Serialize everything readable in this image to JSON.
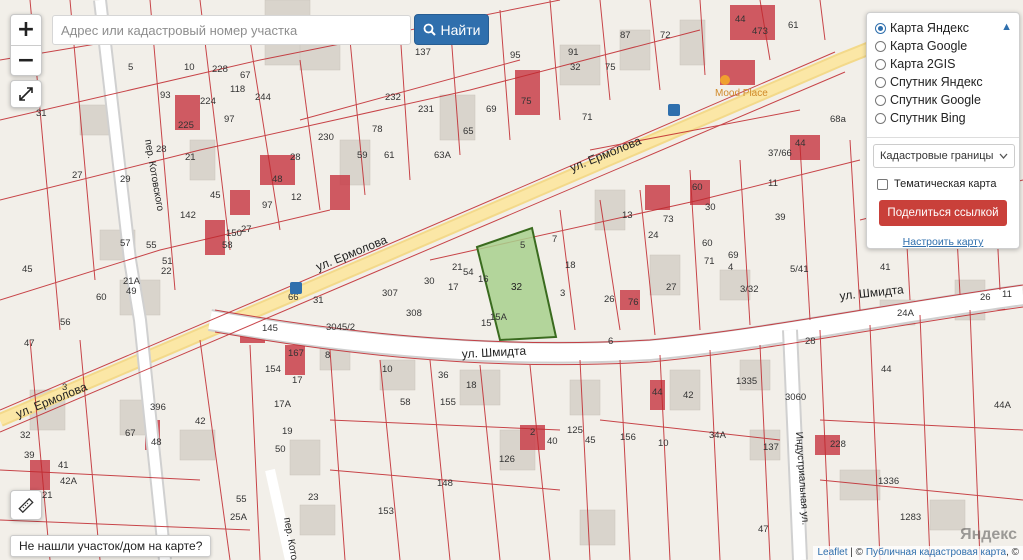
{
  "search": {
    "placeholder": "Адрес или кадастровый номер участка",
    "button_label": "Найти"
  },
  "zoom": {
    "in_label": "+",
    "out_label": "−"
  },
  "panel": {
    "basemaps": [
      {
        "label": "Карта Яндекс",
        "selected": true
      },
      {
        "label": "Карта Google",
        "selected": false
      },
      {
        "label": "Карта 2GIS",
        "selected": false
      },
      {
        "label": "Спутник Яндекс",
        "selected": false
      },
      {
        "label": "Спутник Google",
        "selected": false
      },
      {
        "label": "Спутник Bing",
        "selected": false
      }
    ],
    "layer_select": "Кадастровые границы",
    "thematic_label": "Тематическая карта",
    "thematic_checked": false,
    "share_label": "Поделиться ссылкой",
    "setup_label": "Настроить карту"
  },
  "notfound_label": "Не нашли участок/дом на карте?",
  "attribution": {
    "leaflet": "Leaflet",
    "sep": " | © ",
    "pkk": "Публичная кадастровая карта",
    "tail": ", ©"
  },
  "yandex_logo": "Яндекс",
  "map": {
    "streets": [
      {
        "name": "ул. Ермолова",
        "id": "ermolova-upper"
      },
      {
        "name": "ул. Ермолова",
        "id": "ermolova-mid"
      },
      {
        "name": "ул. Ермолова",
        "id": "ermolova-lower"
      },
      {
        "name": "ул. Шмидта",
        "id": "shmidta-mid"
      },
      {
        "name": "ул. Шмидта",
        "id": "shmidta-right"
      },
      {
        "name": "пер. Котовского",
        "id": "kotovskogo"
      },
      {
        "name": "пер. Кото",
        "id": "koto-bottom"
      },
      {
        "name": "Индустриальная ул.",
        "id": "industrialnaya"
      }
    ],
    "poi": "Mood Place",
    "selected_parcel": "32",
    "colors": {
      "background": "#f2efe9",
      "parcel_line": "#c0272d",
      "building": "#d9d4cc",
      "highlight_building": "#c9404a",
      "road": "#fbe7a6",
      "selected_fill": "#a8d08d",
      "selected_stroke": "#3a6b1f"
    },
    "parcel_labels": [
      "87",
      "72",
      "44",
      "473",
      "61",
      "91",
      "32",
      "75",
      "95",
      "137",
      "232",
      "231",
      "228",
      "10",
      "5",
      "93",
      "224",
      "225",
      "244",
      "31",
      "230",
      "78",
      "59",
      "61",
      "63А",
      "65",
      "69",
      "75",
      "71",
      "68a",
      "97",
      "67",
      "118",
      "37/66",
      "44",
      "11",
      "28",
      "48",
      "12",
      "21",
      "29",
      "27",
      "97",
      "45",
      "142",
      "28",
      "27",
      "150",
      "58",
      "57",
      "55",
      "51",
      "22",
      "21А",
      "49",
      "60",
      "45",
      "47",
      "56",
      "5",
      "7",
      "18",
      "21",
      "54",
      "17",
      "16",
      "30",
      "307",
      "308",
      "66",
      "31",
      "145",
      "3045/2",
      "15",
      "15А",
      "3",
      "26",
      "76",
      "27",
      "3/32",
      "39",
      "5/41",
      "41",
      "24А",
      "26",
      "11",
      "13",
      "24",
      "60",
      "73",
      "30",
      "69",
      "71",
      "60",
      "4",
      "6",
      "8",
      "10",
      "36",
      "18",
      "58",
      "155",
      "154",
      "167",
      "17",
      "17А",
      "19",
      "50",
      "67",
      "396",
      "48",
      "42",
      "32",
      "39",
      "41",
      "42А",
      "3",
      "21",
      "23",
      "25А",
      "55",
      "153",
      "148",
      "126",
      "2",
      "40",
      "125",
      "45",
      "156",
      "10",
      "44",
      "42",
      "34А",
      "1335",
      "137",
      "228",
      "1336",
      "1283",
      "44",
      "3060",
      "44А",
      "47",
      "28"
    ]
  }
}
